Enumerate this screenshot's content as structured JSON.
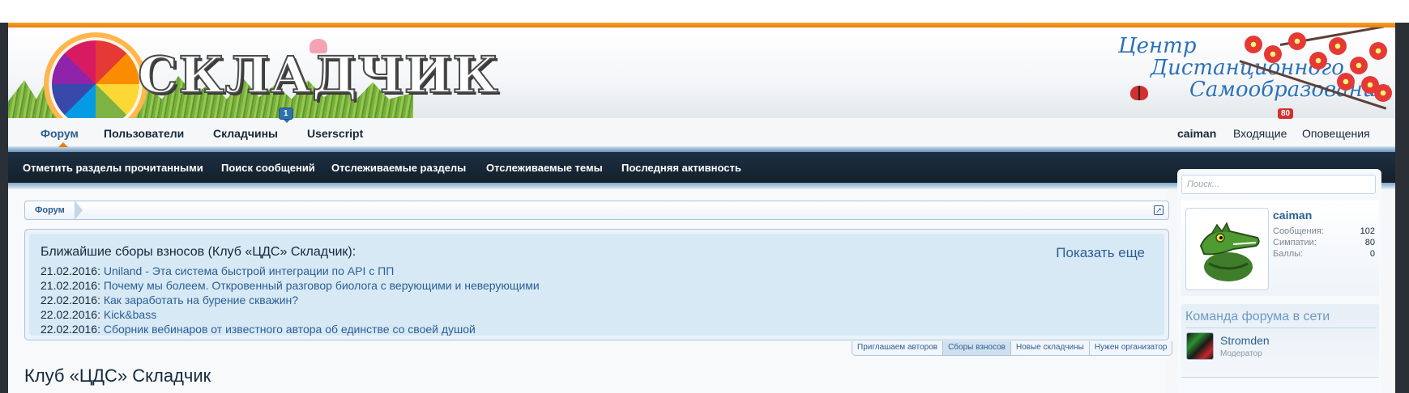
{
  "colors": {
    "accent_orange": "#e87d10",
    "link_blue": "#2b5e94",
    "nav_dark": "#1c2f42",
    "notice_bg": "#d8e9f6",
    "badge_red": "#d32f2f",
    "badge_blue": "#2f70ad"
  },
  "header": {
    "logo_text": "СКЛАДЧИК",
    "cds_line1": "Центр",
    "cds_line2": "Дистанционного",
    "cds_line3": "Самообразования"
  },
  "nav": {
    "tabs": [
      {
        "label": "Форум",
        "active": true
      },
      {
        "label": "Пользователи"
      },
      {
        "label": "Складчины",
        "badge": "1"
      },
      {
        "label": "Userscript"
      }
    ],
    "user": {
      "username": "caiman",
      "inbox": "Входящие",
      "inbox_badge": "80",
      "alerts": "Оповещения"
    }
  },
  "subnav": {
    "links": [
      "Отметить разделы прочитанными",
      "Поиск сообщений",
      "Отслеживаемые разделы",
      "Отслеживаемые темы",
      "Последняя активность"
    ]
  },
  "breadcrumb": {
    "items": [
      "Форум"
    ],
    "expand_icon": "external-link-icon"
  },
  "notice": {
    "title": "Ближайшие сборы взносов (Клуб «ЦДС» Складчик):",
    "show_more": "Показать еще",
    "items": [
      {
        "date": "21.02.2016",
        "title": "Uniland - Эта система быстрой интеграции по API с ПП"
      },
      {
        "date": "21.02.2016",
        "title": "Почему мы болеем. Откровенный разговор биолога с верующими и неверующими"
      },
      {
        "date": "22.02.2016",
        "title": "Как заработать на бурение скважин?"
      },
      {
        "date": "22.02.2016",
        "title": "Kick&bass"
      },
      {
        "date": "22.02.2016",
        "title": "Сборник вебинаров от известного автора об единстве со своей душой"
      }
    ],
    "tabs": [
      {
        "label": "Приглашаем авторов"
      },
      {
        "label": "Сборы взносов",
        "active": true
      },
      {
        "label": "Новые складчины"
      },
      {
        "label": "Нужен организатор"
      }
    ]
  },
  "page_title": "Клуб «ЦДС» Складчик",
  "sidebar": {
    "search": {
      "placeholder": "Поиск...",
      "value": ""
    },
    "user": {
      "name": "caiman",
      "stats": [
        {
          "label": "Сообщения:",
          "value": "102"
        },
        {
          "label": "Симпатии:",
          "value": "80"
        },
        {
          "label": "Баллы:",
          "value": "0"
        }
      ]
    },
    "staff": {
      "heading": "Команда форума в сети",
      "members": [
        {
          "name": "Stromden",
          "role": "Модератор"
        }
      ]
    }
  }
}
